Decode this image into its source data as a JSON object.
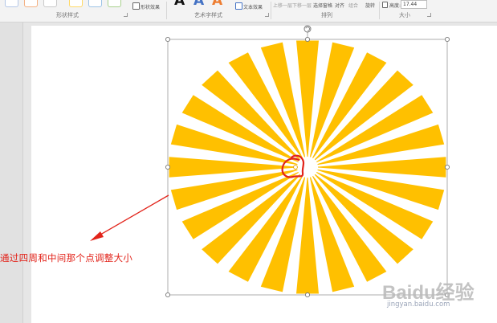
{
  "ribbon": {
    "shape_styles_label": "形状样式",
    "shape_effects_label": "形状效果",
    "art_text_styles_label": "艺术字样式",
    "text_effects_label": "文本效果",
    "bring_forward_label": "上移一层",
    "send_backward_label": "下移一层",
    "selection_pane_label": "选择窗格",
    "align_label": "对齐",
    "group_label": "组合",
    "rotate_label": "旋转",
    "arrange_label": "排列",
    "height_label": "高度:",
    "height_value": "17.44",
    "size_label": "大小",
    "wordart_glyph": "A",
    "swatch_colors": [
      "#b4c7e7",
      "#f4b183",
      "#c9c9c9",
      "#ffd966",
      "#9dc3e6",
      "#a9d18e"
    ],
    "wordart_colors": [
      "#111111",
      "#4472c4",
      "#ed7d31"
    ]
  },
  "shape": {
    "name": "sunburst",
    "color": "#ffc000"
  },
  "annotation": {
    "note": "通过四周和中间那个点调整大小",
    "color": "#e2231a"
  },
  "watermark": {
    "brand": "Baidu经验",
    "url": "jingyan.baidu.com"
  }
}
